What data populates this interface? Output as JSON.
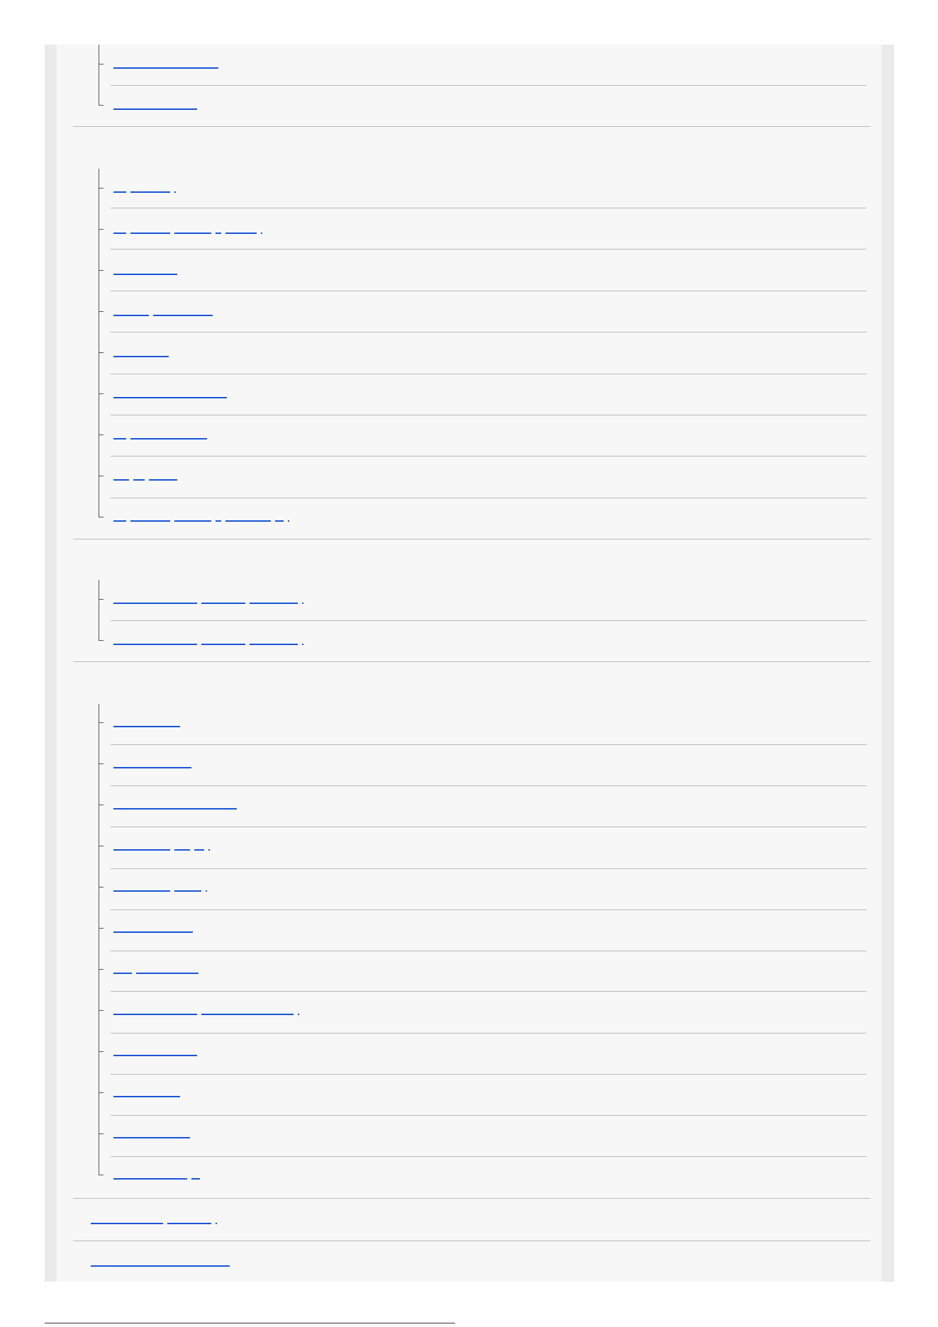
{
  "footer": {
    "text": ""
  },
  "sections": [
    {
      "indent": "nested",
      "items": 2
    },
    {
      "indent": "nested",
      "items": 9
    },
    {
      "indent": "nested",
      "items": 2
    },
    {
      "indent": "nested",
      "items": 12
    },
    {
      "indent": "top",
      "items": 1
    },
    {
      "indent": "top",
      "items": 1
    }
  ]
}
